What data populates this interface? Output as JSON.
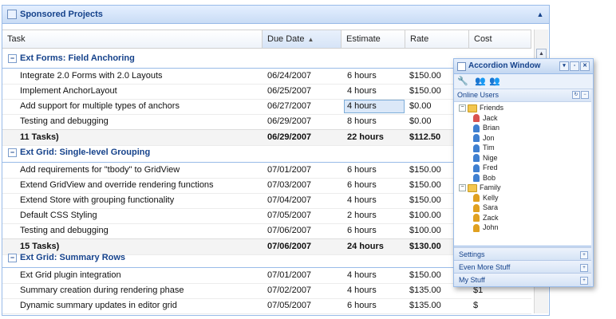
{
  "panel": {
    "title": "Sponsored Projects",
    "collapse_tool": "▲"
  },
  "columns": [
    {
      "label": "Task"
    },
    {
      "label": "Due Date",
      "sort_indicator": "▲"
    },
    {
      "label": "Estimate"
    },
    {
      "label": "Rate"
    },
    {
      "label": "Cost"
    }
  ],
  "groups": [
    {
      "label": "Ext Forms: Field Anchoring",
      "rows": [
        {
          "task": "Integrate 2.0 Forms with 2.0 Layouts",
          "due": "06/24/2007",
          "estimate": "6 hours",
          "rate": "$150.00",
          "cost": ""
        },
        {
          "task": "Implement AnchorLayout",
          "due": "06/25/2007",
          "estimate": "4 hours",
          "rate": "$150.00",
          "cost": ""
        },
        {
          "task": "Add support for multiple types of anchors",
          "due": "06/27/2007",
          "estimate": "4 hours",
          "rate": "$0.00",
          "cost": ""
        },
        {
          "task": "Testing and debugging",
          "due": "06/29/2007",
          "estimate": "8 hours",
          "rate": "$0.00",
          "cost": ""
        }
      ],
      "summary": {
        "task": "11 Tasks)",
        "due": "06/29/2007",
        "estimate": "22 hours",
        "rate": "$112.50",
        "cost": ""
      }
    },
    {
      "label": "Ext Grid: Single-level Grouping",
      "rows": [
        {
          "task": "Add requirements for \"tbody\" to GridView",
          "due": "07/01/2007",
          "estimate": "6 hours",
          "rate": "$150.00",
          "cost": ""
        },
        {
          "task": "Extend GridView and override rendering functions",
          "due": "07/03/2007",
          "estimate": "6 hours",
          "rate": "$150.00",
          "cost": ""
        },
        {
          "task": "Extend Store with grouping functionality",
          "due": "07/04/2007",
          "estimate": "4 hours",
          "rate": "$150.00",
          "cost": ""
        },
        {
          "task": "Default CSS Styling",
          "due": "07/05/2007",
          "estimate": "2 hours",
          "rate": "$100.00",
          "cost": ""
        },
        {
          "task": "Testing and debugging",
          "due": "07/06/2007",
          "estimate": "6 hours",
          "rate": "$100.00",
          "cost": ""
        }
      ],
      "summary": {
        "task": "15 Tasks)",
        "due": "07/06/2007",
        "estimate": "24 hours",
        "rate": "$130.00",
        "cost": ""
      }
    },
    {
      "label": "Ext Grid: Summary Rows",
      "rows": [
        {
          "task": "Ext Grid plugin integration",
          "due": "07/01/2007",
          "estimate": "4 hours",
          "rate": "$150.00",
          "cost": ""
        },
        {
          "task": "Summary creation during rendering phase",
          "due": "07/02/2007",
          "estimate": "4 hours",
          "rate": "$135.00",
          "cost": "$1"
        },
        {
          "task": "Dynamic summary updates in editor grid",
          "due": "07/05/2007",
          "estimate": "6 hours",
          "rate": "$135.00",
          "cost": "$"
        }
      ]
    }
  ],
  "editing_value": "4 hours",
  "accordion": {
    "title": "Accordion Window",
    "tools": [
      "▾",
      "▫",
      "✕"
    ],
    "toolbar_icons": [
      "🔧",
      "👥",
      "👥"
    ],
    "open_section": "Online Users",
    "tree": [
      {
        "type": "folder",
        "label": "Friends",
        "level": 0
      },
      {
        "type": "user",
        "label": "Jack",
        "level": 1,
        "color": "#d9534f"
      },
      {
        "type": "user",
        "label": "Brian",
        "level": 1,
        "color": "#3f7fd0"
      },
      {
        "type": "user",
        "label": "Jon",
        "level": 1,
        "color": "#3f7fd0"
      },
      {
        "type": "user",
        "label": "Tim",
        "level": 1,
        "color": "#3f7fd0"
      },
      {
        "type": "user",
        "label": "Nige",
        "level": 1,
        "color": "#3f7fd0"
      },
      {
        "type": "user",
        "label": "Fred",
        "level": 1,
        "color": "#3f7fd0"
      },
      {
        "type": "user",
        "label": "Bob",
        "level": 1,
        "color": "#3f7fd0"
      },
      {
        "type": "folder",
        "label": "Family",
        "level": 0
      },
      {
        "type": "user",
        "label": "Kelly",
        "level": 1,
        "color": "#e0a020"
      },
      {
        "type": "user",
        "label": "Sara",
        "level": 1,
        "color": "#e0a020"
      },
      {
        "type": "user",
        "label": "Zack",
        "level": 1,
        "color": "#e0a020"
      },
      {
        "type": "user",
        "label": "John",
        "level": 1,
        "color": "#e0a020"
      }
    ],
    "collapsed_sections": [
      "Settings",
      "Even More Stuff",
      "My Stuff"
    ]
  }
}
